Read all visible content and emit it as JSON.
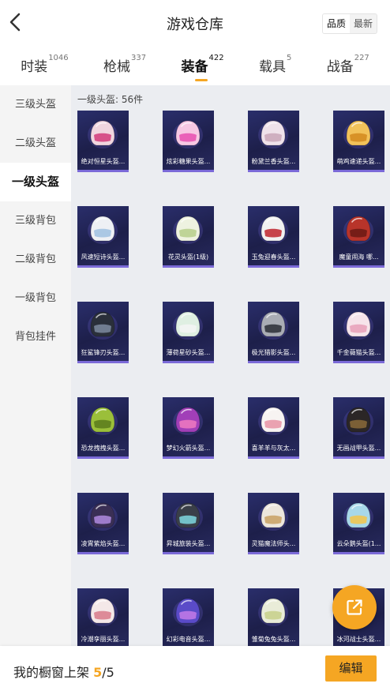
{
  "header": {
    "title": "游戏仓库",
    "sort_options": [
      "品质",
      "最新"
    ],
    "sort_selected": "品质"
  },
  "tabs": [
    {
      "label": "时装",
      "count": "1046"
    },
    {
      "label": "枪械",
      "count": "337"
    },
    {
      "label": "装备",
      "count": "422",
      "active": true
    },
    {
      "label": "载具",
      "count": "5"
    },
    {
      "label": "战备",
      "count": "227"
    }
  ],
  "sidebar": {
    "items": [
      {
        "label": "三级头盔"
      },
      {
        "label": "二级头盔"
      },
      {
        "label": "一级头盔",
        "active": true
      },
      {
        "label": "三级背包"
      },
      {
        "label": "二级背包"
      },
      {
        "label": "一级背包"
      },
      {
        "label": "背包挂件"
      }
    ]
  },
  "content": {
    "section_label": "一级头盔: 56件",
    "items": [
      {
        "name": "绝对恒星头盔...",
        "icon": "helmet-icon",
        "color": "#f0d6df",
        "accent": "#d23a7a"
      },
      {
        "name": "炫彩糖果头盔...",
        "icon": "helmet-icon",
        "color": "#f7c8e3",
        "accent": "#e84fb0"
      },
      {
        "name": "粉黛兰香头盔...",
        "icon": "helmet-icon",
        "color": "#efe2ea",
        "accent": "#c9a6b8"
      },
      {
        "name": "萌鸡速递头盔...",
        "icon": "helmet-icon",
        "color": "#f2c25a",
        "accent": "#d48a1e"
      },
      {
        "name": "风速短诗头盔...",
        "icon": "helmet-icon",
        "color": "#eef0f4",
        "accent": "#9fc1e0"
      },
      {
        "name": "花灵头盔(1级)",
        "icon": "helmet-icon",
        "color": "#eef2e0",
        "accent": "#b6cf8a"
      },
      {
        "name": "玉兔迎春头盔...",
        "icon": "helmet-icon",
        "color": "#f1f1f1",
        "accent": "#c0242d"
      },
      {
        "name": "魔童闹海 哪...",
        "icon": "helmet-icon",
        "color": "#b8342a",
        "accent": "#6a1a14"
      },
      {
        "name": "狂鲨锋刃头盔...",
        "icon": "helmet-icon",
        "color": "#2a2f3a",
        "accent": "#7d8aa0"
      },
      {
        "name": "薄荷星砂头盔...",
        "icon": "helmet-icon",
        "color": "#dfefe2",
        "accent": "#f4f4f4"
      },
      {
        "name": "极光猎影头盔...",
        "icon": "helmet-icon",
        "color": "#a9acb4",
        "accent": "#2b2e36"
      },
      {
        "name": "千金薇猫头盔...",
        "icon": "helmet-icon",
        "color": "#f6e4ea",
        "accent": "#e8a0b8"
      },
      {
        "name": "恐龙拽拽头盔...",
        "icon": "helmet-icon",
        "color": "#9bbf3a",
        "accent": "#5a7a1c"
      },
      {
        "name": "梦幻火箭头盔...",
        "icon": "helmet-icon",
        "color": "#a13fb8",
        "accent": "#f07ac0"
      },
      {
        "name": "喜羊羊与灰太...",
        "icon": "helmet-icon",
        "color": "#f7f3f2",
        "accent": "#e893a6"
      },
      {
        "name": "无画战甲头盔...",
        "icon": "helmet-icon",
        "color": "#2b2626",
        "accent": "#8a6a3a"
      },
      {
        "name": "凌霄紫焰头盔...",
        "icon": "helmet-icon",
        "color": "#3a2f55",
        "accent": "#b08ae0"
      },
      {
        "name": "昇城旅装头盔...",
        "icon": "helmet-icon",
        "color": "#3a3f48",
        "accent": "#7fd8e0"
      },
      {
        "name": "灵猫魔法师头...",
        "icon": "helmet-icon",
        "color": "#ece6dc",
        "accent": "#c9a063"
      },
      {
        "name": "云朵鹅头盔(1...",
        "icon": "helmet-icon",
        "color": "#a8d8ea",
        "accent": "#f5c64a"
      },
      {
        "name": "冷潮孪丽头盔...",
        "icon": "helmet-icon",
        "color": "#f4e8e8",
        "accent": "#d87a8a"
      },
      {
        "name": "幻彩电音头盔...",
        "icon": "helmet-icon",
        "color": "#5a4bc8",
        "accent": "#c47ae8"
      },
      {
        "name": "雏菊兔兔头盔...",
        "icon": "helmet-icon",
        "color": "#e9ecd8",
        "accent": "#c7d08a"
      },
      {
        "name": "冰河战士头盔...",
        "icon": "helmet-icon",
        "color": "#dfe8ef",
        "accent": "#6a8aa8"
      }
    ]
  },
  "fab": {
    "icon": "share-icon"
  },
  "footer": {
    "label": "我的橱窗上架",
    "count": "5",
    "total": "/5",
    "edit_label": "编辑"
  }
}
